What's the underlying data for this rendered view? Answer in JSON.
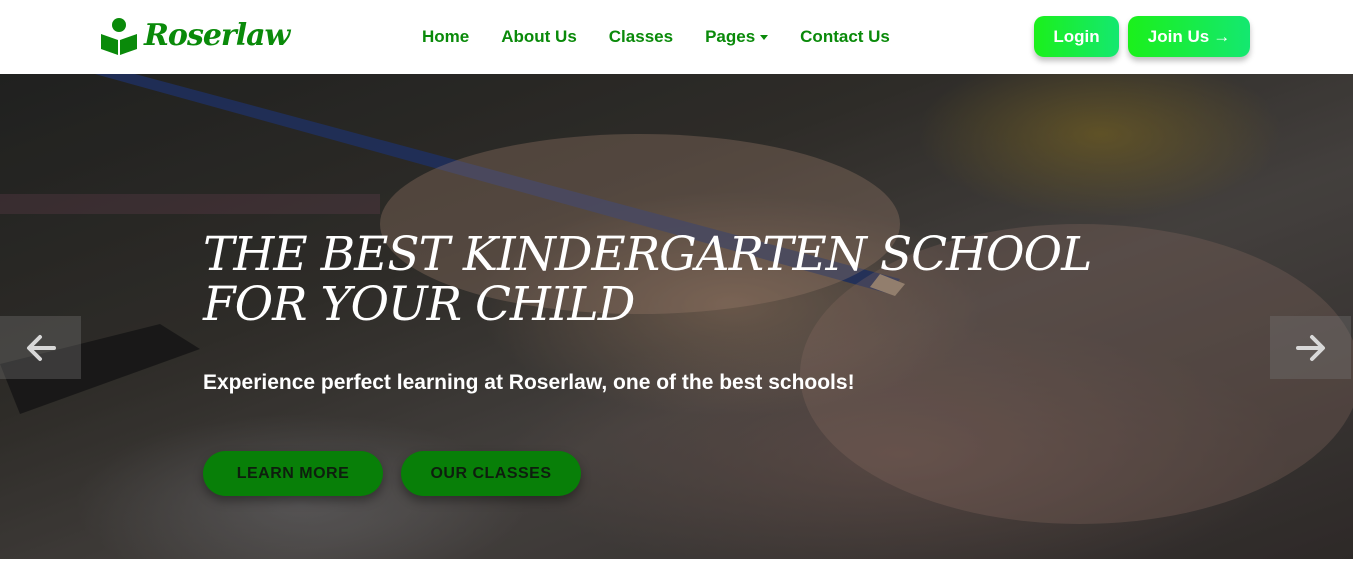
{
  "brand": {
    "name": "Roserlaw",
    "icon": "reader-book-icon",
    "color": "#0a8a0a"
  },
  "nav": {
    "links": [
      {
        "label": "Home"
      },
      {
        "label": "About Us"
      },
      {
        "label": "Classes"
      },
      {
        "label": "Pages",
        "has_dropdown": true
      },
      {
        "label": "Contact Us"
      }
    ]
  },
  "actions": {
    "login_label": "Login",
    "join_label": "Join Us",
    "join_icon": "arrow-right-icon"
  },
  "hero": {
    "title": "THE BEST KINDERGARTEN SCHOOL FOR YOUR CHILD",
    "subtitle": "Experience perfect learning at Roserlaw, one of the best schools!",
    "learn_more_label": "LEARN MORE",
    "our_classes_label": "OUR CLASSES",
    "prev_icon": "arrow-left-icon",
    "next_icon": "arrow-right-icon"
  },
  "colors": {
    "brand_green": "#0a8a0a",
    "button_gradient_start": "#1bf01b",
    "button_gradient_end": "#14e870",
    "hero_button": "#087f08"
  }
}
